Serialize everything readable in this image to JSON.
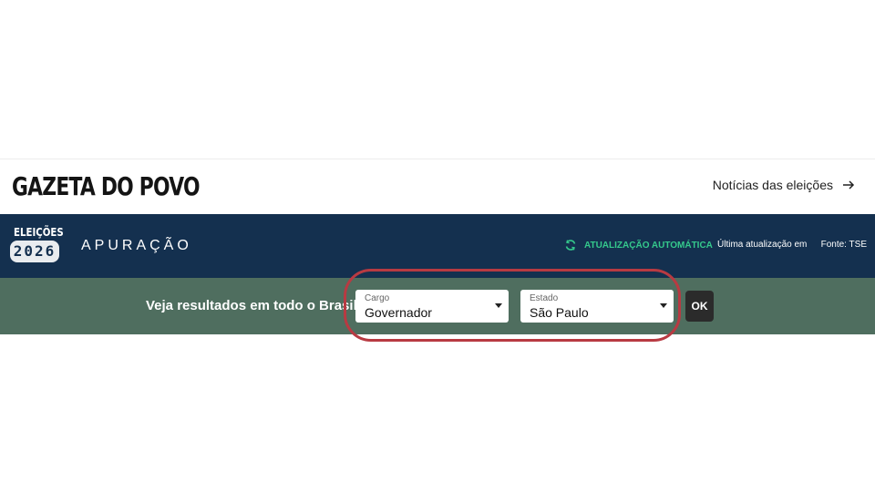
{
  "header": {
    "logo_text": "GAZETA DO POVO",
    "news_link_label": "Notícias das eleições",
    "news_link_icon": "arrow-right-icon"
  },
  "navbar": {
    "badge_top": "ELEIÇÕES",
    "badge_year": "2026",
    "section_title": "APURAÇÃO",
    "auto_update_label": "ATUALIZAÇÃO AUTOMÁTICA",
    "auto_update_icon": "refresh-icon",
    "last_update_label": "Última atualização em",
    "source_label": "Fonte: TSE"
  },
  "filters": {
    "label": "Veja resultados em todo o Brasil",
    "cargo": {
      "caption": "Cargo",
      "value": "Governador",
      "icon": "caret-down-icon"
    },
    "estado": {
      "caption": "Estado",
      "value": "São Paulo",
      "icon": "caret-down-icon"
    },
    "ok_label": "OK"
  },
  "colors": {
    "navbar_bg": "#14304f",
    "filter_bg": "#4f6e5f",
    "accent_green": "#35c98c",
    "highlight_ring": "#b83a42",
    "ok_button_bg": "#2b2b2b"
  }
}
